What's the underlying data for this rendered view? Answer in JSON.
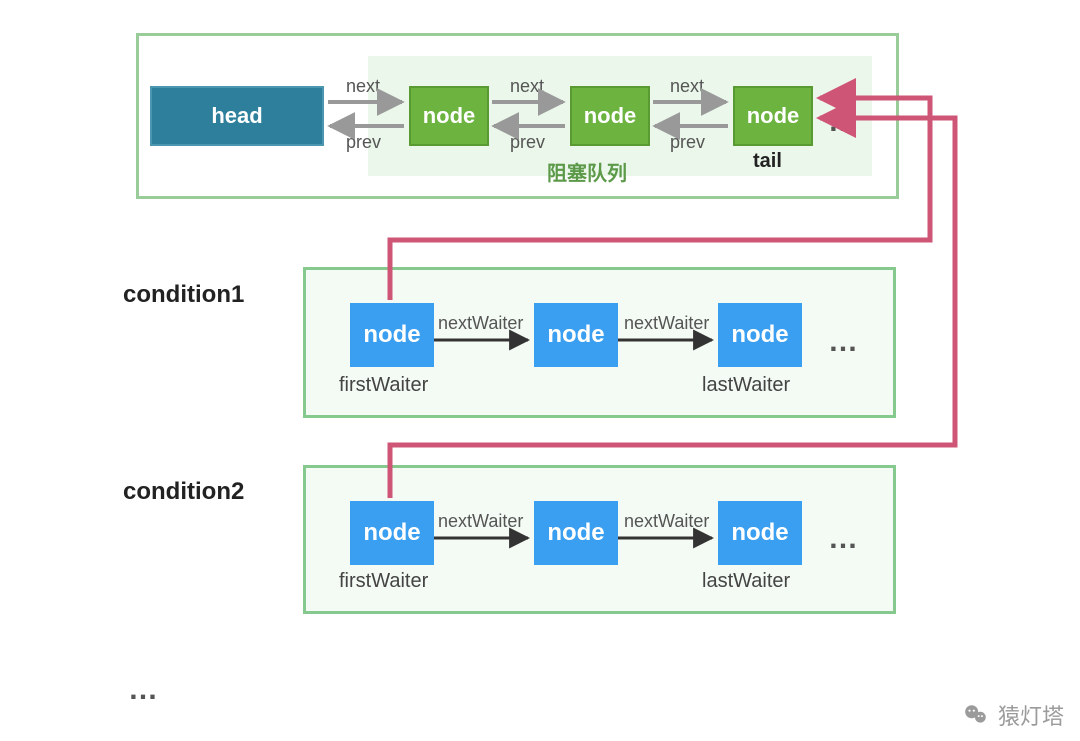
{
  "sync_queue": {
    "head_label": "head",
    "nodes": [
      {
        "label": "node"
      },
      {
        "label": "node"
      },
      {
        "label": "node"
      }
    ],
    "tail_sub_label": "tail",
    "link_next": "next",
    "link_prev": "prev",
    "blocking_label": "阻塞队列",
    "overflow": "…"
  },
  "conditions": [
    {
      "title": "condition1",
      "first_label": "firstWaiter",
      "last_label": "lastWaiter",
      "link_label": "nextWaiter",
      "nodes": [
        {
          "label": "node"
        },
        {
          "label": "node"
        },
        {
          "label": "node"
        }
      ],
      "overflow": "…"
    },
    {
      "title": "condition2",
      "first_label": "firstWaiter",
      "last_label": "lastWaiter",
      "link_label": "nextWaiter",
      "nodes": [
        {
          "label": "node"
        },
        {
          "label": "node"
        },
        {
          "label": "node"
        }
      ],
      "overflow": "…"
    }
  ],
  "more_conditions": "…",
  "watermark": "猿灯塔",
  "colors": {
    "head_fill": "#2d7f9b",
    "green_node_fill": "#6cb33f",
    "blue_node_fill": "#3a9ff0",
    "box_border": "#86c98e",
    "blocking_bg": "#eaf7ea",
    "migrate_arrow": "#cf5577"
  }
}
